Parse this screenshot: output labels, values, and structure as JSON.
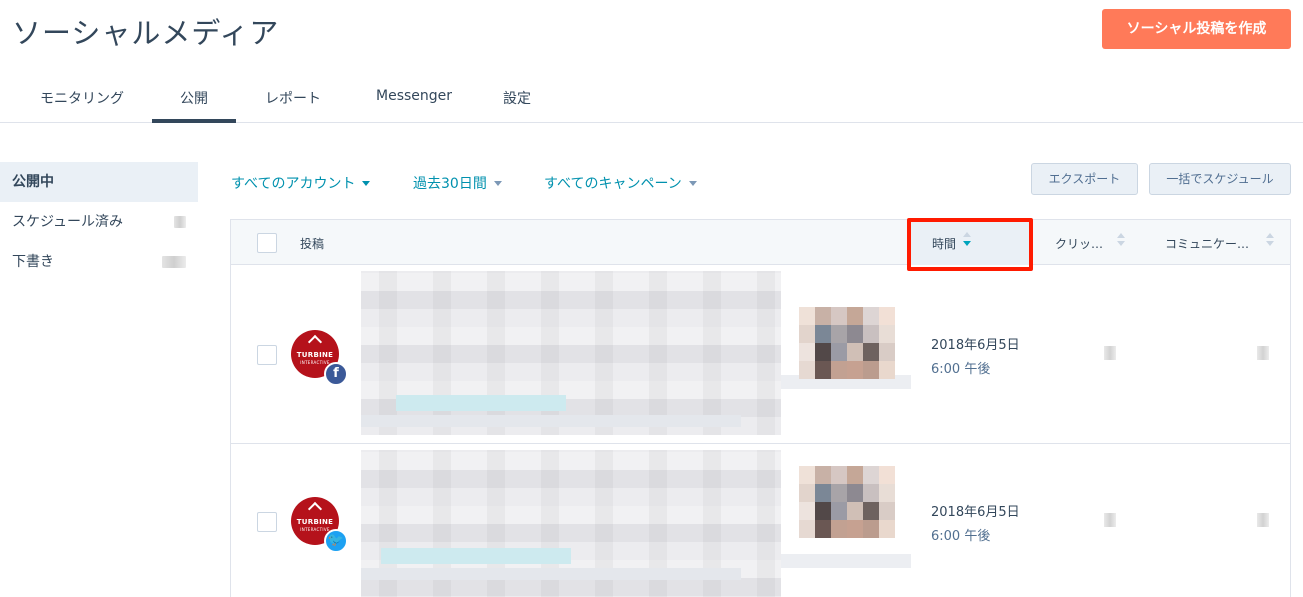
{
  "header": {
    "title": "ソーシャルメディア",
    "create_button": "ソーシャル投稿を作成"
  },
  "tabs": [
    {
      "label": "モニタリング"
    },
    {
      "label": "公開",
      "active": true
    },
    {
      "label": "レポート"
    },
    {
      "label": "Messenger"
    },
    {
      "label": "設定"
    }
  ],
  "sidebar": {
    "items": [
      {
        "label": "公開中",
        "active": true
      },
      {
        "label": "スケジュール済み"
      },
      {
        "label": "下書き"
      }
    ]
  },
  "filters": {
    "account": "すべてのアカウント",
    "period": "過去30日間",
    "campaign": "すべてのキャンペーン"
  },
  "toolbar": {
    "export": "エクスポート",
    "bulk_schedule": "一括でスケジュール"
  },
  "table": {
    "columns": {
      "post": "投稿",
      "time": "時間",
      "clicks": "クリッ…",
      "interactions": "コミュニケー…"
    },
    "sort_column": "時間",
    "sort_direction": "descending",
    "rows": [
      {
        "avatar_text": "TURBINE",
        "avatar_sub": "INTERACTIVE",
        "network": "facebook",
        "network_glyph": "f",
        "date": "2018年6月5日",
        "time": "6:00 午後"
      },
      {
        "avatar_text": "TURBINE",
        "avatar_sub": "INTERACTIVE",
        "network": "twitter",
        "network_glyph": "🐦",
        "date": "2018年6月5日",
        "time": "6:00 午後"
      }
    ]
  },
  "colors": {
    "accent": "#ff7a59",
    "link": "#0091ae",
    "highlight": "#ff1a00",
    "facebook": "#3b5998",
    "twitter": "#1da1f2",
    "avatar": "#b5121b"
  }
}
